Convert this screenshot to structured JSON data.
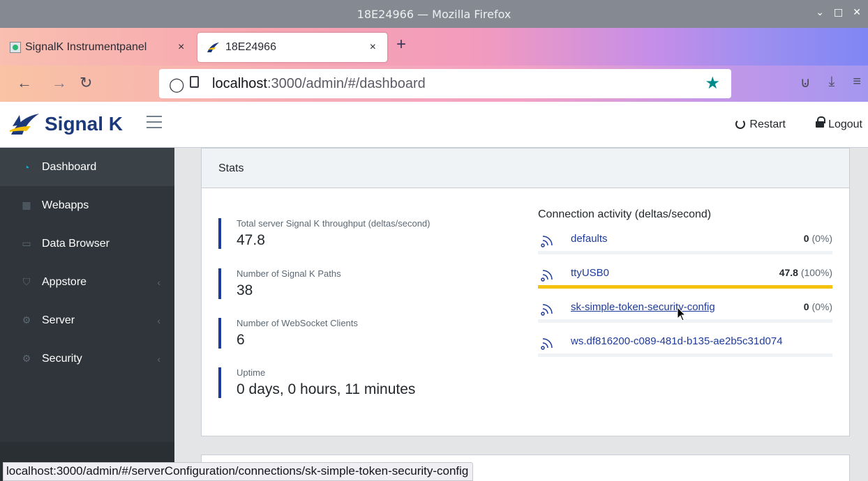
{
  "window": {
    "title": "18E24966 — Mozilla Firefox",
    "controls": [
      "⌄",
      "□",
      "✕"
    ]
  },
  "tabs": [
    {
      "label": "SignalK Instrumentpanel",
      "close": "×"
    },
    {
      "label": "18E24966",
      "close": "×"
    }
  ],
  "new_tab": "+",
  "urlbar": {
    "host": "localhost",
    "rest": ":3000/admin/#/dashboard"
  },
  "app": {
    "brand": "Signal K",
    "restart": "Restart",
    "logout": "Logout",
    "accent": "#1f3b9a",
    "highlight": "#f4c20d"
  },
  "sidebar": {
    "items": [
      {
        "label": "Dashboard",
        "icon": "speedometer-icon",
        "active": true
      },
      {
        "label": "Webapps",
        "icon": "grid-icon"
      },
      {
        "label": "Data Browser",
        "icon": "folder-icon"
      },
      {
        "label": "Appstore",
        "icon": "basket-icon",
        "chevron": "‹"
      },
      {
        "label": "Server",
        "icon": "gear-icon",
        "chevron": "‹"
      },
      {
        "label": "Security",
        "icon": "gear-icon",
        "chevron": "‹"
      }
    ]
  },
  "stats": {
    "header": "Stats",
    "items": [
      {
        "label": "Total server Signal K throughput (deltas/second)",
        "value": "47.8"
      },
      {
        "label": "Number of Signal K Paths",
        "value": "38"
      },
      {
        "label": "Number of WebSocket Clients",
        "value": "6"
      },
      {
        "label": "Uptime",
        "value": "0 days, 0 hours, 11 minutes"
      }
    ],
    "connection_title": "Connection activity (deltas/second)",
    "connections": [
      {
        "name": "defaults",
        "rate": "0",
        "pct": "(0%)",
        "fill": 0
      },
      {
        "name": "ttyUSB0",
        "rate": "47.8",
        "pct": "(100%)",
        "fill": 1
      },
      {
        "name": "sk-simple-token-security-config",
        "rate": "0",
        "pct": "(0%)",
        "fill": 0
      },
      {
        "name": "ws.df816200-c089-481d-b135-ae2b5c31d074",
        "rate": "",
        "pct": "",
        "fill": 0
      }
    ]
  },
  "statusbar": "localhost:3000/admin/#/serverConfiguration/connections/sk-simple-token-security-config"
}
